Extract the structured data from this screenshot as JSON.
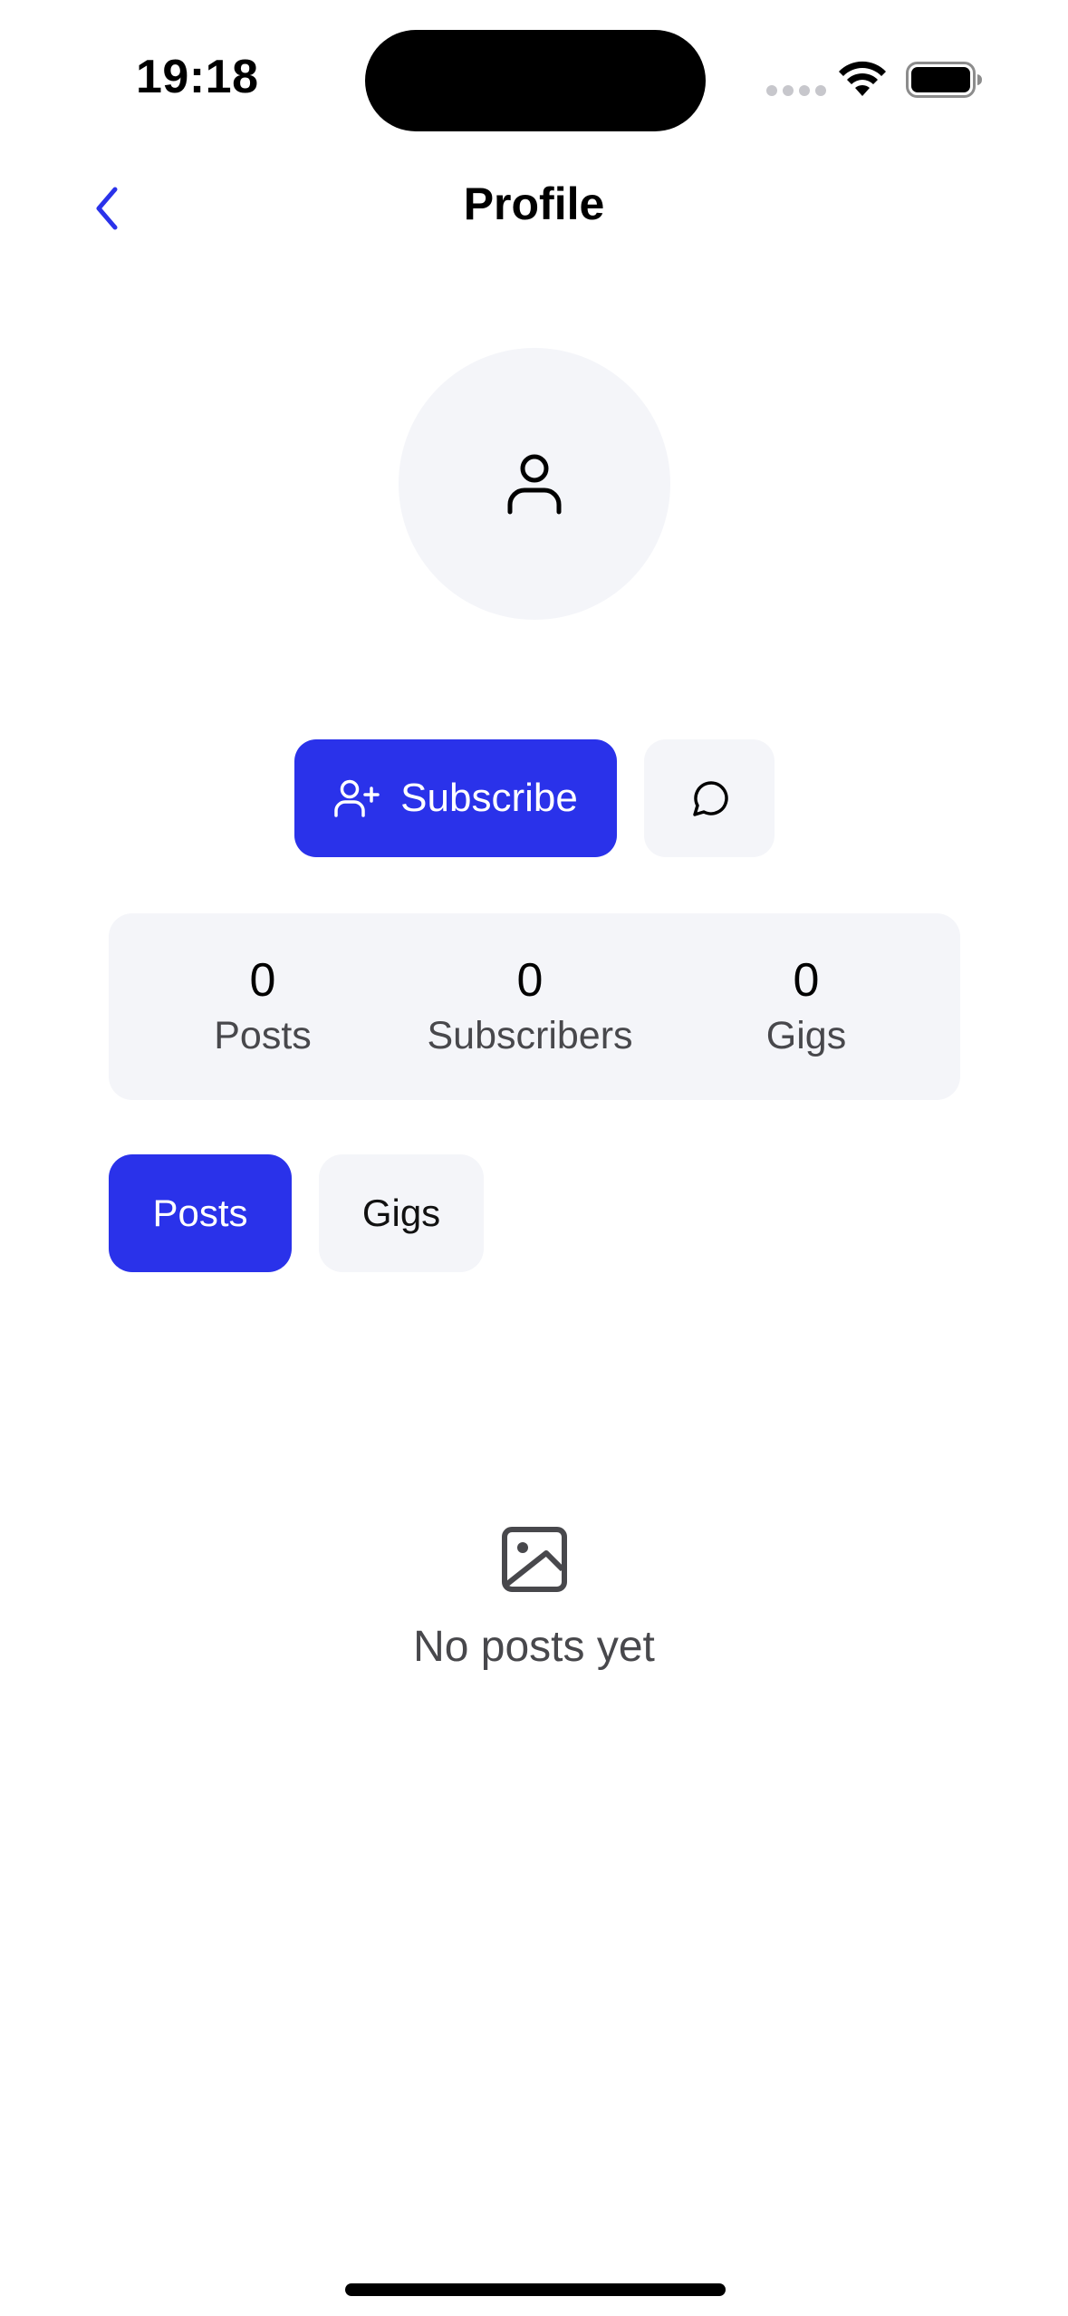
{
  "status_bar": {
    "time": "19:18"
  },
  "nav": {
    "title": "Profile",
    "back_icon": "chevron-left-icon"
  },
  "profile": {
    "avatar_icon": "user-icon"
  },
  "actions": {
    "subscribe_label": "Subscribe",
    "subscribe_icon": "user-plus-icon",
    "message_icon": "message-circle-icon"
  },
  "stats": [
    {
      "value": "0",
      "label": "Posts"
    },
    {
      "value": "0",
      "label": "Subscribers"
    },
    {
      "value": "0",
      "label": "Gigs"
    }
  ],
  "tabs": [
    {
      "label": "Posts",
      "active": true
    },
    {
      "label": "Gigs",
      "active": false
    }
  ],
  "empty_state": {
    "icon": "image-icon",
    "text": "No posts yet"
  },
  "colors": {
    "accent": "#2a32ea",
    "surface": "#f4f5f9",
    "muted_text": "#48484c"
  }
}
